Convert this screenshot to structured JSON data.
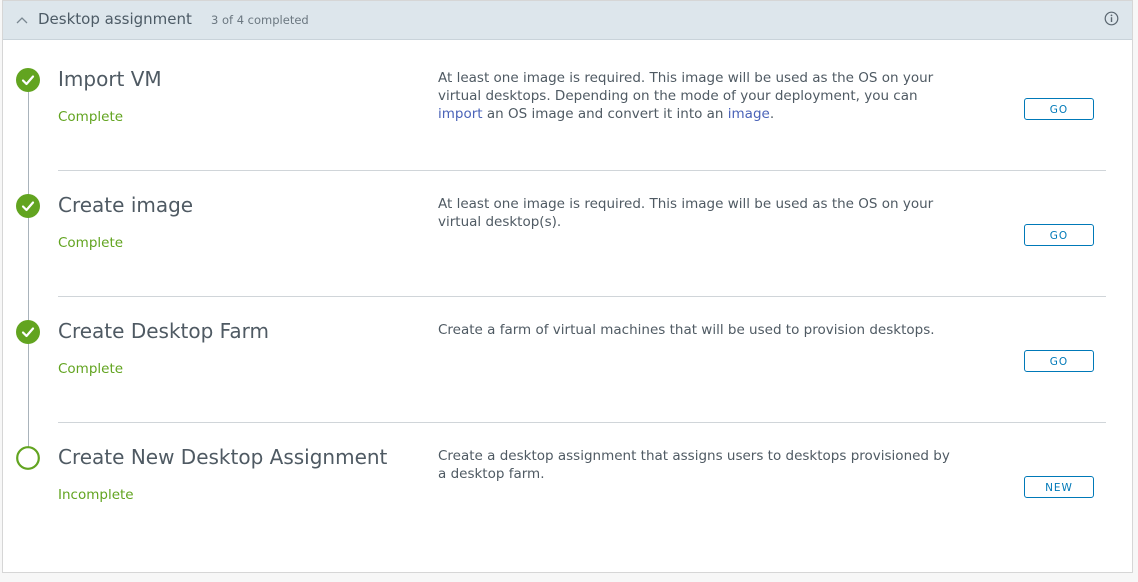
{
  "header": {
    "title": "Desktop assignment",
    "progress": "3 of 4 completed"
  },
  "colors": {
    "complete": "#62a420",
    "link": "#4a63b8",
    "button": "#0079b8"
  },
  "steps": [
    {
      "title": "Import VM",
      "status": "Complete",
      "status_icon": "check-circle-icon",
      "description": {
        "text_before": "At least one image is required. This image will be used as the OS on your virtual desktops. Depending on the mode of your deployment, you can ",
        "link1": "import",
        "text_middle": " an OS image and convert it into an ",
        "link2": "image",
        "text_after": "."
      },
      "button": "GO"
    },
    {
      "title": "Create image",
      "status": "Complete",
      "status_icon": "check-circle-icon",
      "description": "At least one image is required. This image will be used as the OS on your virtual desktop(s).",
      "button": "GO"
    },
    {
      "title": "Create Desktop Farm",
      "status": "Complete",
      "status_icon": "check-circle-icon",
      "description": "Create a farm of virtual machines that will be used to provision desktops.",
      "button": "GO"
    },
    {
      "title": "Create New Desktop Assignment",
      "status": "Incomplete",
      "status_icon": "empty-circle-icon",
      "description": "Create a desktop assignment that assigns users to desktops provisioned by a desktop farm.",
      "button": "NEW"
    }
  ]
}
